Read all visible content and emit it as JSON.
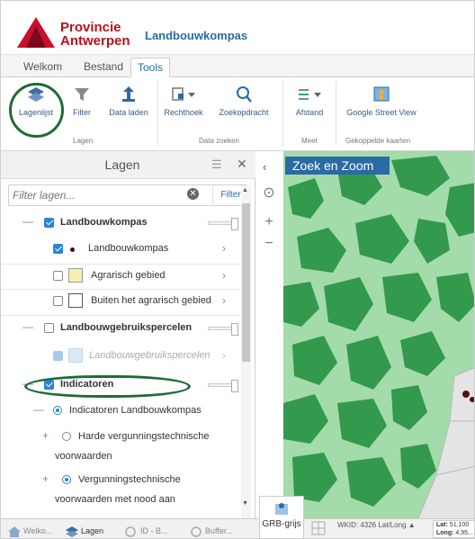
{
  "header": {
    "org_line1": "Provincie",
    "org_line2": "Antwerpen",
    "app_title": "Landbouwkompas"
  },
  "menu_tabs": [
    "Welkom",
    "Bestand",
    "Tools"
  ],
  "active_tab": "Tools",
  "ribbon": {
    "groups": [
      {
        "label": "Lagen",
        "items": [
          "Lagenlijst",
          "Filter",
          "Data laden"
        ]
      },
      {
        "label": "Data zoeken",
        "items": [
          "Rechthoek",
          "Zoekopdracht"
        ]
      },
      {
        "label": "Meet",
        "items": [
          "Afstand"
        ]
      },
      {
        "label": "Gekoppelde kaarten",
        "items": [
          "Google Street View"
        ]
      }
    ]
  },
  "panel": {
    "title": "Lagen",
    "filter_placeholder": "Filter lagen...",
    "filter_button": "Filter",
    "layers": [
      {
        "label": "Landbouwkompas",
        "checked": true,
        "group": true
      },
      {
        "label": "Landbouwkompas",
        "checked": true,
        "symbol": "dot"
      },
      {
        "label": "Agrarisch gebied",
        "checked": false,
        "symbol": "yellow-square"
      },
      {
        "label": "Buiten het agrarisch gebied",
        "checked": false,
        "symbol": "white-square"
      },
      {
        "label": "Landbouwgebruikspercelen",
        "checked": false,
        "group": true
      },
      {
        "label": "Landbouwgebruikspercelen",
        "checked": true,
        "disabled": true,
        "symbol": "lightblue-square"
      },
      {
        "label": "Indicatoren",
        "checked": true,
        "group": true
      },
      {
        "label": "Indicatoren Landbouwkompas",
        "radio": true,
        "selected": true
      },
      {
        "label_line1": "Harde vergunningstechnische",
        "label_line2": "voorwaarden",
        "radio": true,
        "selected": false
      },
      {
        "label_line1": "Vergunningstechnische",
        "label_line2": "voorwaarden met nood aan",
        "radio": true,
        "selected": true
      }
    ]
  },
  "map": {
    "search_title": "Zoek en Zoom",
    "zoom_in": "+",
    "zoom_out": "−",
    "basemap_label": "GRB-grijs",
    "wkid_text": "WKID: 4326 Lat/Long ▲",
    "lat_label": "Lat:",
    "lat_value": "51,100",
    "long_label": "Long:",
    "long_value": "4,95..."
  },
  "bottom_tabs": [
    "Welko...",
    "Lagen",
    "ID - B...",
    "Buffer..."
  ],
  "active_bottom_tab": "Lagen",
  "colors": {
    "brand_blue": "#2b6aa5",
    "brand_red": "#b5121b",
    "map_dark_green": "#2f9447",
    "map_light_green": "#8fd199",
    "highlight_circle": "#1e6b38",
    "checkbox_blue": "#2b84d6"
  }
}
